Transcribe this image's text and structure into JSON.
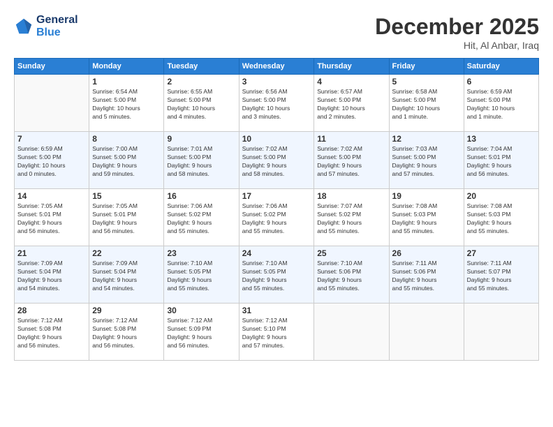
{
  "header": {
    "logo_line1": "General",
    "logo_line2": "Blue",
    "month": "December 2025",
    "location": "Hit, Al Anbar, Iraq"
  },
  "weekdays": [
    "Sunday",
    "Monday",
    "Tuesday",
    "Wednesday",
    "Thursday",
    "Friday",
    "Saturday"
  ],
  "weeks": [
    [
      {
        "day": "",
        "info": ""
      },
      {
        "day": "1",
        "info": "Sunrise: 6:54 AM\nSunset: 5:00 PM\nDaylight: 10 hours\nand 5 minutes."
      },
      {
        "day": "2",
        "info": "Sunrise: 6:55 AM\nSunset: 5:00 PM\nDaylight: 10 hours\nand 4 minutes."
      },
      {
        "day": "3",
        "info": "Sunrise: 6:56 AM\nSunset: 5:00 PM\nDaylight: 10 hours\nand 3 minutes."
      },
      {
        "day": "4",
        "info": "Sunrise: 6:57 AM\nSunset: 5:00 PM\nDaylight: 10 hours\nand 2 minutes."
      },
      {
        "day": "5",
        "info": "Sunrise: 6:58 AM\nSunset: 5:00 PM\nDaylight: 10 hours\nand 1 minute."
      },
      {
        "day": "6",
        "info": "Sunrise: 6:59 AM\nSunset: 5:00 PM\nDaylight: 10 hours\nand 1 minute."
      }
    ],
    [
      {
        "day": "7",
        "info": "Sunrise: 6:59 AM\nSunset: 5:00 PM\nDaylight: 10 hours\nand 0 minutes."
      },
      {
        "day": "8",
        "info": "Sunrise: 7:00 AM\nSunset: 5:00 PM\nDaylight: 9 hours\nand 59 minutes."
      },
      {
        "day": "9",
        "info": "Sunrise: 7:01 AM\nSunset: 5:00 PM\nDaylight: 9 hours\nand 58 minutes."
      },
      {
        "day": "10",
        "info": "Sunrise: 7:02 AM\nSunset: 5:00 PM\nDaylight: 9 hours\nand 58 minutes."
      },
      {
        "day": "11",
        "info": "Sunrise: 7:02 AM\nSunset: 5:00 PM\nDaylight: 9 hours\nand 57 minutes."
      },
      {
        "day": "12",
        "info": "Sunrise: 7:03 AM\nSunset: 5:00 PM\nDaylight: 9 hours\nand 57 minutes."
      },
      {
        "day": "13",
        "info": "Sunrise: 7:04 AM\nSunset: 5:01 PM\nDaylight: 9 hours\nand 56 minutes."
      }
    ],
    [
      {
        "day": "14",
        "info": "Sunrise: 7:05 AM\nSunset: 5:01 PM\nDaylight: 9 hours\nand 56 minutes."
      },
      {
        "day": "15",
        "info": "Sunrise: 7:05 AM\nSunset: 5:01 PM\nDaylight: 9 hours\nand 56 minutes."
      },
      {
        "day": "16",
        "info": "Sunrise: 7:06 AM\nSunset: 5:02 PM\nDaylight: 9 hours\nand 55 minutes."
      },
      {
        "day": "17",
        "info": "Sunrise: 7:06 AM\nSunset: 5:02 PM\nDaylight: 9 hours\nand 55 minutes."
      },
      {
        "day": "18",
        "info": "Sunrise: 7:07 AM\nSunset: 5:02 PM\nDaylight: 9 hours\nand 55 minutes."
      },
      {
        "day": "19",
        "info": "Sunrise: 7:08 AM\nSunset: 5:03 PM\nDaylight: 9 hours\nand 55 minutes."
      },
      {
        "day": "20",
        "info": "Sunrise: 7:08 AM\nSunset: 5:03 PM\nDaylight: 9 hours\nand 55 minutes."
      }
    ],
    [
      {
        "day": "21",
        "info": "Sunrise: 7:09 AM\nSunset: 5:04 PM\nDaylight: 9 hours\nand 54 minutes."
      },
      {
        "day": "22",
        "info": "Sunrise: 7:09 AM\nSunset: 5:04 PM\nDaylight: 9 hours\nand 54 minutes."
      },
      {
        "day": "23",
        "info": "Sunrise: 7:10 AM\nSunset: 5:05 PM\nDaylight: 9 hours\nand 55 minutes."
      },
      {
        "day": "24",
        "info": "Sunrise: 7:10 AM\nSunset: 5:05 PM\nDaylight: 9 hours\nand 55 minutes."
      },
      {
        "day": "25",
        "info": "Sunrise: 7:10 AM\nSunset: 5:06 PM\nDaylight: 9 hours\nand 55 minutes."
      },
      {
        "day": "26",
        "info": "Sunrise: 7:11 AM\nSunset: 5:06 PM\nDaylight: 9 hours\nand 55 minutes."
      },
      {
        "day": "27",
        "info": "Sunrise: 7:11 AM\nSunset: 5:07 PM\nDaylight: 9 hours\nand 55 minutes."
      }
    ],
    [
      {
        "day": "28",
        "info": "Sunrise: 7:12 AM\nSunset: 5:08 PM\nDaylight: 9 hours\nand 56 minutes."
      },
      {
        "day": "29",
        "info": "Sunrise: 7:12 AM\nSunset: 5:08 PM\nDaylight: 9 hours\nand 56 minutes."
      },
      {
        "day": "30",
        "info": "Sunrise: 7:12 AM\nSunset: 5:09 PM\nDaylight: 9 hours\nand 56 minutes."
      },
      {
        "day": "31",
        "info": "Sunrise: 7:12 AM\nSunset: 5:10 PM\nDaylight: 9 hours\nand 57 minutes."
      },
      {
        "day": "",
        "info": ""
      },
      {
        "day": "",
        "info": ""
      },
      {
        "day": "",
        "info": ""
      }
    ]
  ]
}
